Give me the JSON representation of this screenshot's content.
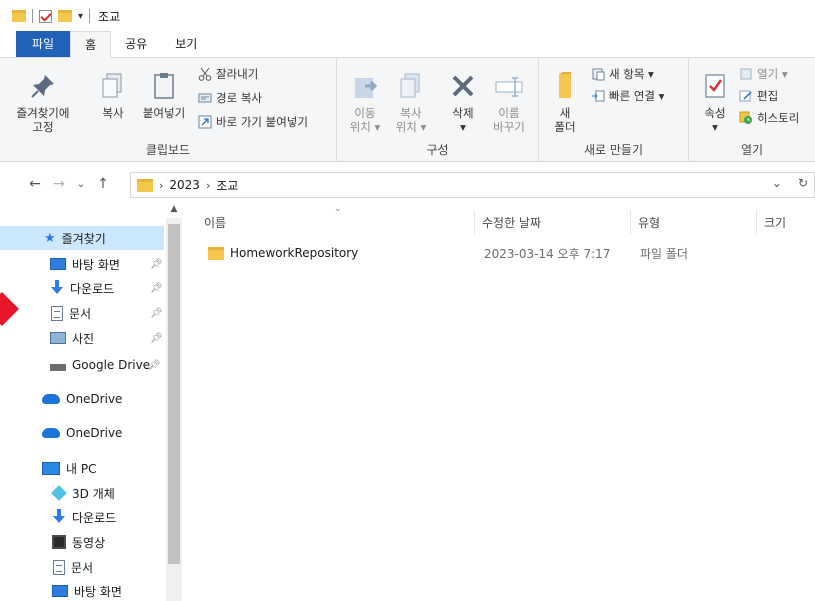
{
  "window": {
    "title": "조교"
  },
  "tabs": [
    "파일",
    "홈",
    "공유",
    "보기"
  ],
  "ribbon": {
    "clipboard": {
      "label": "클립보드",
      "pin": "즐겨찾기에\n고정",
      "pin_l1": "즐겨찾기에",
      "pin_l2": "고정",
      "copy": "복사",
      "paste": "붙여넣기",
      "cut": "잘라내기",
      "copy_path": "경로 복사",
      "paste_shortcut": "바로 가기 붙여넣기"
    },
    "organize": {
      "label": "구성",
      "move_l1": "이동",
      "move_l2": "위치 ▾",
      "copyto_l1": "복사",
      "copyto_l2": "위치 ▾",
      "delete_l1": "삭제",
      "delete_l2": "▾",
      "rename_l1": "이름",
      "rename_l2": "바꾸기"
    },
    "new": {
      "label": "새로 만들기",
      "folder_l1": "새",
      "folder_l2": "폴더",
      "new_item": "새 항목 ▾",
      "easy_access": "빠른 연결 ▾"
    },
    "open": {
      "label": "열기",
      "properties_l1": "속성",
      "properties_l2": "▾",
      "open": "열기 ▾",
      "edit": "편집",
      "history": "히스토리"
    }
  },
  "address": {
    "path": [
      "2023",
      "조교"
    ],
    "sep": "›"
  },
  "sidebar": {
    "quick_access": "즐겨찾기",
    "items": [
      {
        "label": "바탕 화면",
        "icon": "desktop-icon",
        "pinned": true
      },
      {
        "label": "다운로드",
        "icon": "download-icon",
        "pinned": true
      },
      {
        "label": "문서",
        "icon": "document-icon",
        "pinned": true
      },
      {
        "label": "사진",
        "icon": "pictures-icon",
        "pinned": true
      },
      {
        "label": "Google Drive",
        "icon": "drive-icon",
        "pinned": true
      }
    ],
    "onedrive1": "OneDrive",
    "onedrive2": "OneDrive",
    "this_pc": "내 PC",
    "pc_items": [
      {
        "label": "3D 개체",
        "icon": "3d-objects-icon"
      },
      {
        "label": "다운로드",
        "icon": "download-icon"
      },
      {
        "label": "동영상",
        "icon": "video-icon"
      },
      {
        "label": "문서",
        "icon": "document-icon"
      },
      {
        "label": "바탕 화면",
        "icon": "desktop-icon"
      }
    ]
  },
  "columns": {
    "name": "이름",
    "modified": "수정한 날짜",
    "type": "유형",
    "size": "크기"
  },
  "files": [
    {
      "name": "HomeworkRepository",
      "modified": "2023-03-14 오후 7:17",
      "type": "파일 폴더",
      "size": ""
    }
  ],
  "colors": {
    "accent": "#1f62b8",
    "selection": "#cce8ff",
    "folder": "#f6c64e"
  }
}
